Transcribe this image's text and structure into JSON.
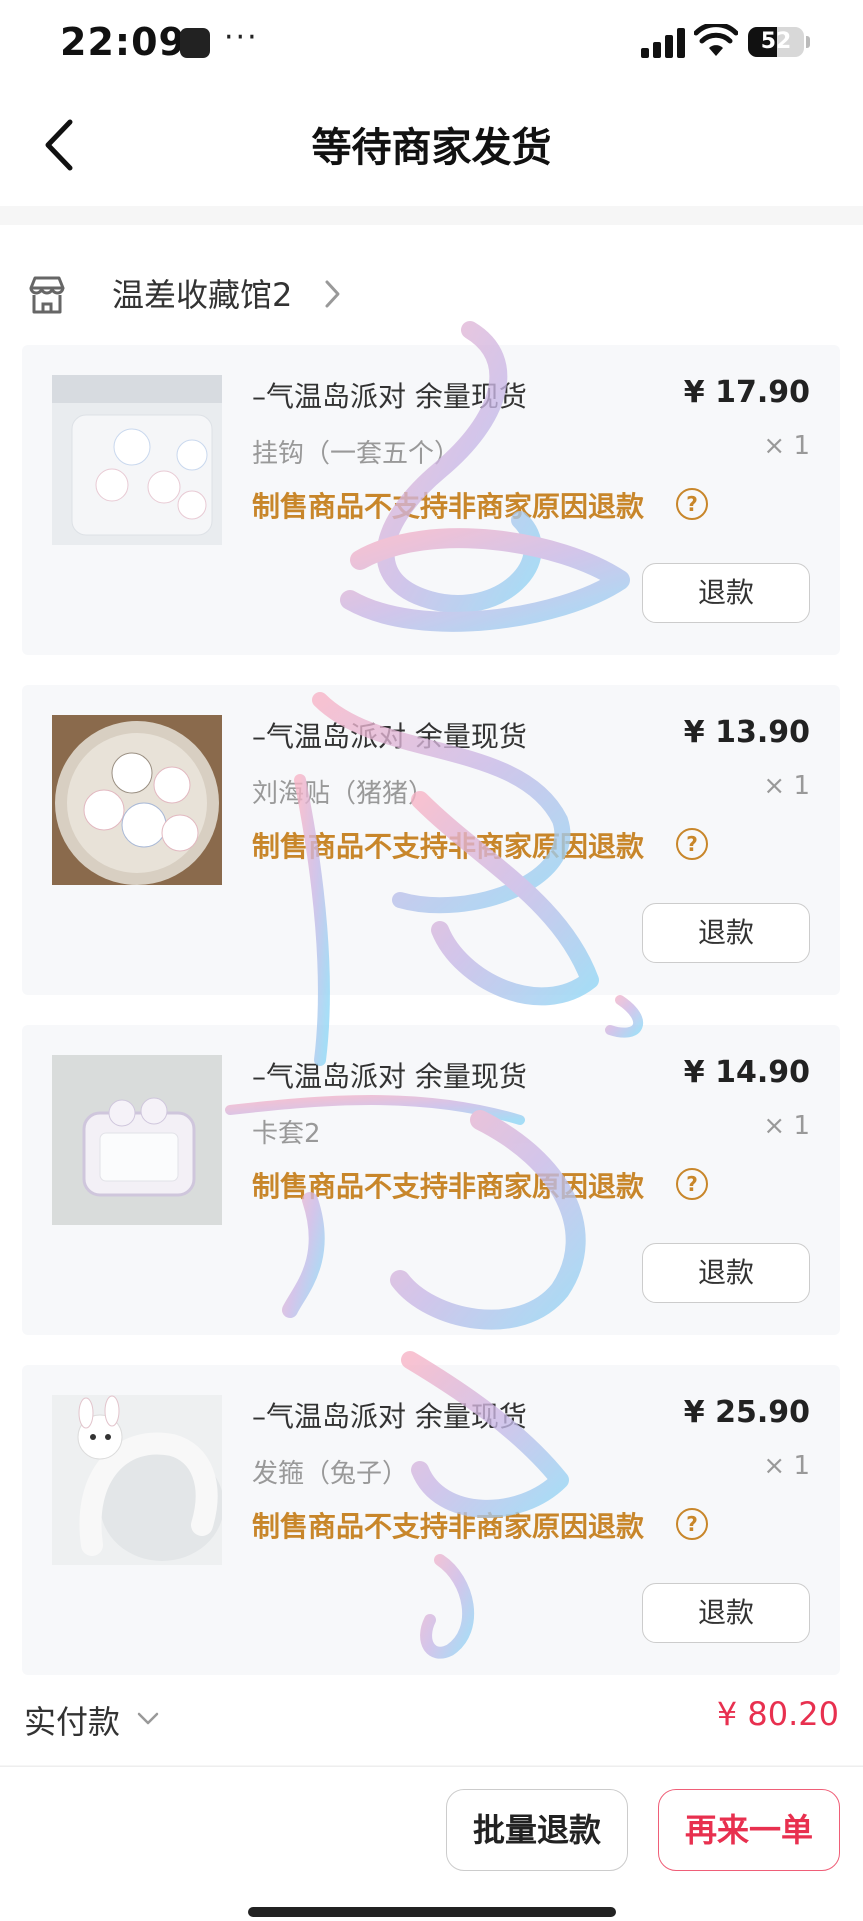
{
  "status_bar": {
    "time": "22:09",
    "dots": "···",
    "battery": "52",
    "battery_level": 0.52,
    "icons": [
      "app-icon",
      "signal-icon",
      "wifi-icon",
      "battery-icon"
    ]
  },
  "nav": {
    "back_icon": "chevron-left-icon",
    "title": "等待商家发货"
  },
  "store": {
    "icon": "store-icon",
    "name": "温差收藏馆2",
    "chevron_icon": "chevron-right-icon"
  },
  "items": [
    {
      "title": "–气温岛派对 余量现货",
      "variant": "挂钩（一套五个）",
      "notice": "制售商品不支持非商家原因退款",
      "price": "¥ 17.90",
      "qty": "× 1",
      "refund_label": "退款"
    },
    {
      "title": "–气温岛派对 余量现货",
      "variant": "刘海贴（猪猪）",
      "notice": "制售商品不支持非商家原因退款",
      "price": "¥ 13.90",
      "qty": "× 1",
      "refund_label": "退款"
    },
    {
      "title": "–气温岛派对 余量现货",
      "variant": "卡套2",
      "notice": "制售商品不支持非商家原因退款",
      "price": "¥ 14.90",
      "qty": "× 1",
      "refund_label": "退款"
    },
    {
      "title": "–气温岛派对 余量现货",
      "variant": "发箍（兔子）",
      "notice": "制售商品不支持非商家原因退款",
      "price": "¥ 25.90",
      "qty": "× 1",
      "refund_label": "退款"
    }
  ],
  "total": {
    "label": "实付款",
    "amount": "¥ 80.20"
  },
  "actions": {
    "batch_refund": "批量退款",
    "reorder": "再来一单"
  },
  "colors": {
    "accent": "#e8304f",
    "notice": "#c8862a",
    "card_bg": "#f7f8fa"
  }
}
